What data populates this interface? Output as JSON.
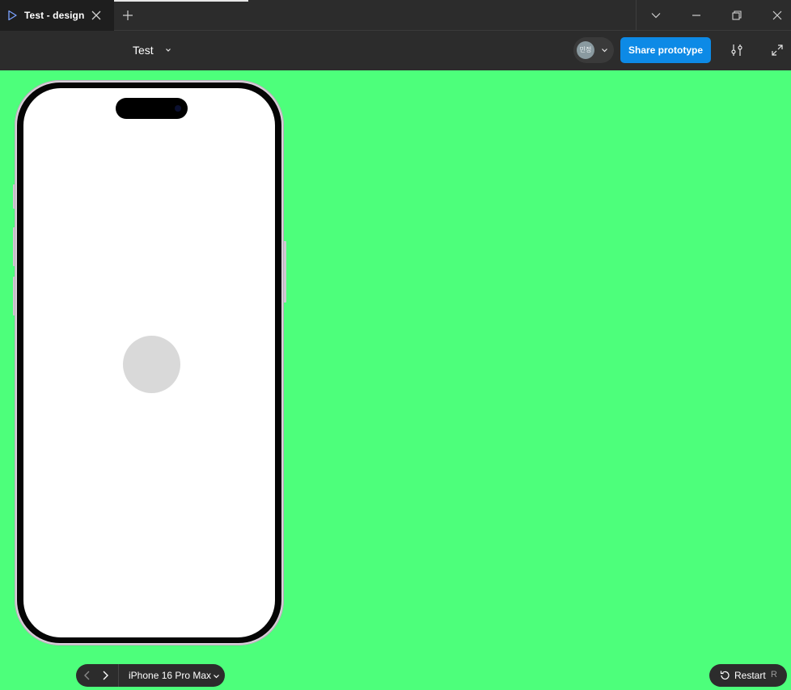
{
  "window": {
    "tab_title": "Test - design",
    "icons": {
      "tab": "play-icon",
      "close_tab": "close-icon",
      "new_tab": "plus-icon",
      "tab_list": "chevron-down-icon",
      "minimize": "minimize-icon",
      "restore": "restore-icon",
      "close_window": "close-icon"
    }
  },
  "toolbar": {
    "file_name": "Test",
    "avatar_initials": "민정",
    "share_label": "Share prototype",
    "icons": {
      "file_menu": "chevron-down-icon",
      "settings": "sliders-icon",
      "fullscreen": "expand-icon"
    }
  },
  "canvas": {
    "background_color": "#4dff7b",
    "device_frame": "iPhone",
    "screen_color": "#ffffff",
    "circle_color": "#d9d9d9"
  },
  "bottom_bar": {
    "device_name": "iPhone 16 Pro Max",
    "restart_label": "Restart",
    "restart_shortcut": "R",
    "icons": {
      "prev": "chevron-left-icon",
      "next": "chevron-right-icon",
      "device_menu": "chevron-down-icon",
      "restart": "restart-icon"
    }
  },
  "colors": {
    "accent": "#0d8ae6",
    "chrome": "#2c2c2c"
  }
}
